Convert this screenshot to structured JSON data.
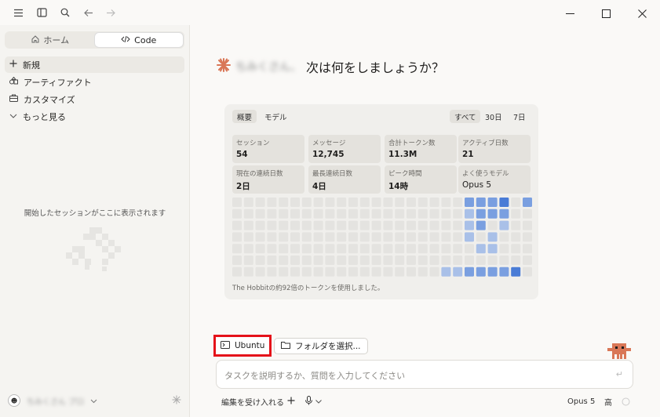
{
  "sidebar": {
    "tabs": [
      {
        "label": "ホーム",
        "icon": "home-icon"
      },
      {
        "label": "Code",
        "icon": "code-icon"
      }
    ],
    "items": [
      {
        "label": "新規",
        "icon": "plus-icon"
      },
      {
        "label": "アーティファクト",
        "icon": "artifact-icon"
      },
      {
        "label": "カスタマイズ",
        "icon": "briefcase-icon"
      },
      {
        "label": "もっと見る",
        "icon": "chevron-down-icon"
      }
    ],
    "empty_text": "開始したセッションがここに表示されます",
    "user_name": "ちみくさん プロ"
  },
  "main": {
    "greeting_name": "ちみくさん、",
    "greeting": "次は何をしましょうか？"
  },
  "stats": {
    "tabs": [
      "概要",
      "モデル"
    ],
    "ranges": [
      "すべて",
      "30日",
      "7日"
    ],
    "cards": [
      {
        "label": "セッション",
        "value": "54"
      },
      {
        "label": "メッセージ",
        "value": "12,745"
      },
      {
        "label": "合計トークン数",
        "value": "11.3M"
      },
      {
        "label": "アクティブ日数",
        "value": "21"
      },
      {
        "label": "現在の連続日数",
        "value": "2日"
      },
      {
        "label": "最長連続日数",
        "value": "4日"
      },
      {
        "label": "ピーク時間",
        "value": "14時"
      },
      {
        "label": "よく使うモデル",
        "value": "Opus 5"
      }
    ],
    "footnote": "The Hobbitの約92倍のトークンを使用しました。",
    "colors": {
      "empty": "#e4e3e0",
      "l1": "#a9c0e8",
      "l2": "#7a9fe0",
      "l3": "#4a7cd6"
    }
  },
  "composer": {
    "env_label": "Ubuntu",
    "folder_label": "フォルダを選択...",
    "placeholder": "タスクを説明するか、質問を入力してください",
    "accept_edits": "編集を受け入れる",
    "model": "Opus 5",
    "effort": "高"
  }
}
